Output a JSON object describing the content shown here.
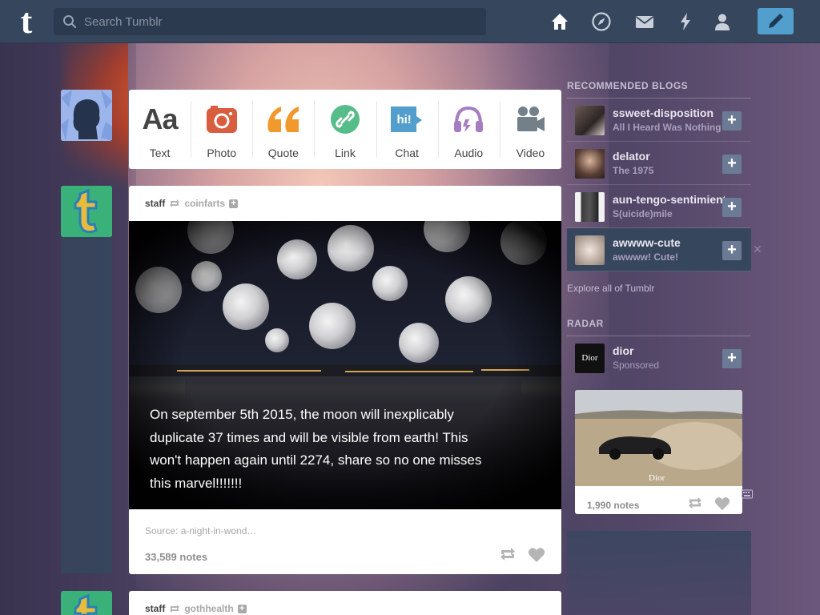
{
  "search": {
    "placeholder": "Search Tumblr"
  },
  "logo": {
    "glyph": "t"
  },
  "nav": {
    "icons": [
      "home-icon",
      "explore-icon",
      "inbox-icon",
      "activity-icon",
      "account-icon"
    ],
    "compose_icon": "pencil-icon"
  },
  "post_types": [
    {
      "label": "Text",
      "glyph": "Aa",
      "color": "#444444"
    },
    {
      "label": "Photo",
      "color": "#d95e40"
    },
    {
      "label": "Quote",
      "glyph": "“",
      "color": "#f2992e"
    },
    {
      "label": "Link",
      "color": "#56bc8a"
    },
    {
      "label": "Chat",
      "glyph": "hi!",
      "color": "#529ecc"
    },
    {
      "label": "Audio",
      "color": "#a77dc2"
    },
    {
      "label": "Video",
      "color": "#748089"
    }
  ],
  "posts": [
    {
      "author": "staff",
      "source": "coinfarts",
      "caption": "On september 5th 2015, the moon will inexplicably duplicate 37 times and will be visible from earth! This won't happen again until 2274, share so no one misses this marvel!!!!!!!",
      "source_line": "Source: a-night-in-wond…",
      "notes": "33,589 notes"
    },
    {
      "author": "staff",
      "source": "gothhealth"
    }
  ],
  "sidebar": {
    "recommended_title": "RECOMMENDED BLOGS",
    "blogs": [
      {
        "name": "ssweet-disposition",
        "subtitle": "All I Heard Was Nothing"
      },
      {
        "name": "delator",
        "subtitle": "The 1975"
      },
      {
        "name": "aun-tengo-sentimientos",
        "subtitle": "S(uicide)mile"
      },
      {
        "name": "awwww-cute",
        "subtitle": "awwww! Cute!"
      }
    ],
    "explore_link": "Explore all of Tumblr",
    "radar_title": "RADAR",
    "radar": {
      "name": "dior",
      "subtitle": "Sponsored",
      "thumb_text": "Dior",
      "image_text": "Dior",
      "notes": "1,990 notes"
    }
  },
  "colors": {
    "navbar": "#36465d",
    "accent": "#529ecc",
    "staff_avatar": "#3bb17a"
  }
}
